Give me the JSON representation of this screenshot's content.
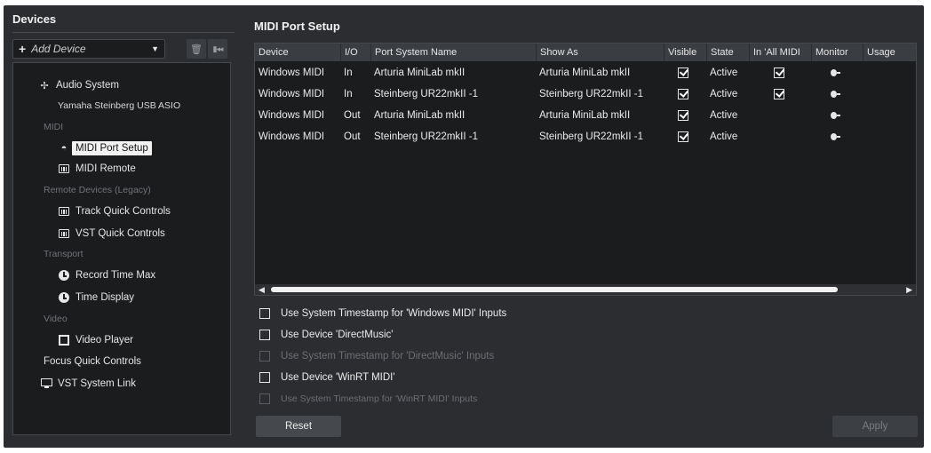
{
  "devices_panel": {
    "title": "Devices",
    "add_device_label": "Add Device",
    "tree": {
      "audio_system": "Audio System",
      "audio_driver": "Yamaha Steinberg USB ASIO",
      "midi_category": "MIDI",
      "midi_port_setup": "MIDI Port Setup",
      "midi_remote": "MIDI Remote",
      "remote_devices_category": "Remote Devices (Legacy)",
      "track_quick_controls": "Track Quick Controls",
      "vst_quick_controls": "VST Quick Controls",
      "transport_category": "Transport",
      "record_time_max": "Record Time Max",
      "time_display": "Time Display",
      "video_category": "Video",
      "video_player": "Video Player",
      "focus_quick_controls": "Focus Quick Controls",
      "vst_system_link": "VST System Link"
    }
  },
  "midi_port_setup": {
    "title": "MIDI Port Setup",
    "columns": [
      "Device",
      "I/O",
      "Port System Name",
      "Show As",
      "Visible",
      "State",
      "In 'All MIDI",
      "Monitor",
      "Usage"
    ],
    "rows": [
      {
        "device": "Windows MIDI",
        "io": "In",
        "port_system_name": "Arturia MiniLab mkII",
        "show_as": "Arturia MiniLab mkII",
        "visible": true,
        "state": "Active",
        "in_all_midi": true,
        "monitor": true
      },
      {
        "device": "Windows MIDI",
        "io": "In",
        "port_system_name": "Steinberg UR22mkII -1",
        "show_as": "Steinberg UR22mkII -1",
        "visible": true,
        "state": "Active",
        "in_all_midi": true,
        "monitor": true
      },
      {
        "device": "Windows MIDI",
        "io": "Out",
        "port_system_name": "Arturia MiniLab mkII",
        "show_as": "Arturia MiniLab mkII",
        "visible": true,
        "state": "Active",
        "in_all_midi": false,
        "monitor": true
      },
      {
        "device": "Windows MIDI",
        "io": "Out",
        "port_system_name": "Steinberg UR22mkII -1",
        "show_as": "Steinberg UR22mkII -1",
        "visible": true,
        "state": "Active",
        "in_all_midi": false,
        "monitor": true
      }
    ],
    "options": [
      {
        "label": "Use System Timestamp for 'Windows MIDI' Inputs",
        "checked": false,
        "enabled": true
      },
      {
        "label": "Use Device 'DirectMusic'",
        "checked": false,
        "enabled": true
      },
      {
        "label": "Use System Timestamp for 'DirectMusic' Inputs",
        "checked": false,
        "enabled": false
      },
      {
        "label": "Use Device 'WinRT MIDI'",
        "checked": false,
        "enabled": true
      },
      {
        "label": "Use System Timestamp for 'WinRT MIDI' Inputs",
        "checked": false,
        "enabled": false
      }
    ],
    "reset_label": "Reset",
    "apply_label": "Apply"
  }
}
